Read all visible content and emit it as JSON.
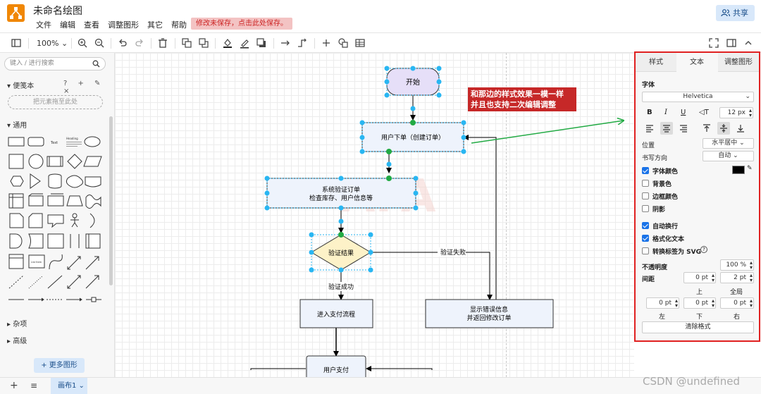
{
  "app": {
    "doc_title": "未命名绘图",
    "menu": [
      "文件",
      "编辑",
      "查看",
      "调整图形",
      "其它",
      "帮助"
    ],
    "unsaved_notice": "修改未保存，点击此处保存。",
    "share_label": "共享"
  },
  "toolbar": {
    "zoom": "100%"
  },
  "sidebar": {
    "search_placeholder": "键入 / 进行搜索",
    "scratchpad_label": "便笺本",
    "scratchpad_tools": "? + ✎ ×",
    "dropzone_label": "把元素拖至此处",
    "general_label": "通用",
    "misc_label": "杂项",
    "advanced_label": "高级",
    "more_shapes_label": "+ 更多图形",
    "shape_text_sample": "Text",
    "shape_heading_sample": "Heading",
    "shape_list_sample": "List Item"
  },
  "diagram": {
    "start": "开始",
    "order": "用户下单（创建订单）",
    "verify_line1": "系统验证订单",
    "verify_line2": "检查库存、用户信息等",
    "decision": "验证结果",
    "fail_label": "验证失败",
    "success_label": "验证成功",
    "pay_flow": "进入支付流程",
    "error_line1": "显示错误信息",
    "error_line2": "并返回修改订单",
    "user_pay": "用户支付",
    "callout_line1": "和那边的样式效果一模一样",
    "callout_line2": "并且也支持二次编辑调整"
  },
  "panel": {
    "tabs": [
      "样式",
      "文本",
      "调整图形"
    ],
    "active_tab": "文本",
    "font_label": "字体",
    "font_value": "Helvetica",
    "font_size": "12 px",
    "position_label": "位置",
    "position_value": "水平居中",
    "writing_dir_label": "书写方向",
    "writing_dir_value": "自动",
    "font_color_label": "字体颜色",
    "bg_color_label": "背景色",
    "border_color_label": "边框颜色",
    "shadow_label": "阴影",
    "wrap_label": "自动换行",
    "formatted_label": "格式化文本",
    "svg_label": "转换标签为 SVG",
    "opacity_label": "不透明度",
    "opacity_value": "100 %",
    "spacing_label": "间距",
    "top_value": "0 pt",
    "global_value": "2 pt",
    "top_label": "上",
    "global_label": "全局",
    "left_value": "0 pt",
    "bottom_value": "0 pt",
    "right_value": "0 pt",
    "left_label": "左",
    "bottom_label": "下",
    "right_label": "右",
    "clear_label": "清除格式",
    "font_color": "#000000",
    "accent": "#1a73e8"
  },
  "bottombar": {
    "page_tab": "画布1"
  },
  "watermark": "CSDN @undefined"
}
